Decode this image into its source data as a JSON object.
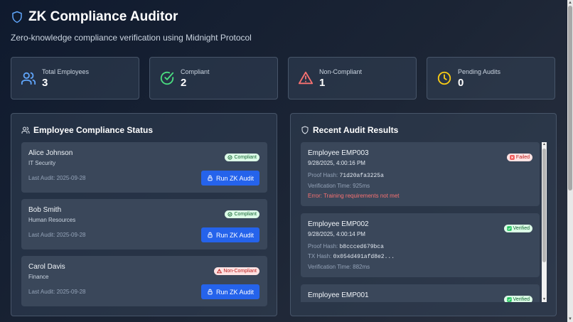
{
  "header": {
    "title": "ZK Compliance Auditor",
    "subtitle": "Zero-knowledge compliance verification using Midnight Protocol"
  },
  "stats": [
    {
      "label": "Total Employees",
      "value": "3",
      "icon": "users-icon",
      "color": "#60a5fa"
    },
    {
      "label": "Compliant",
      "value": "2",
      "icon": "check-circle-icon",
      "color": "#4ade80"
    },
    {
      "label": "Non-Compliant",
      "value": "1",
      "icon": "alert-triangle-icon",
      "color": "#f87171"
    },
    {
      "label": "Pending Audits",
      "value": "0",
      "icon": "clock-icon",
      "color": "#facc15"
    }
  ],
  "employees_panel": {
    "title": "Employee Compliance Status",
    "employees": [
      {
        "name": "Alice Johnson",
        "department": "IT Security",
        "last_audit": "Last Audit: 2025-09-28",
        "status": "Compliant",
        "button": "Run ZK Audit"
      },
      {
        "name": "Bob Smith",
        "department": "Human Resources",
        "last_audit": "Last Audit: 2025-09-28",
        "status": "Compliant",
        "button": "Run ZK Audit"
      },
      {
        "name": "Carol Davis",
        "department": "Finance",
        "last_audit": "Last Audit: 2025-09-28",
        "status": "Non-Compliant",
        "button": "Run ZK Audit"
      }
    ]
  },
  "audit_panel": {
    "title": "Recent Audit Results",
    "results": [
      {
        "title": "Employee EMP003",
        "time": "9/28/2025, 4:00:16 PM",
        "status": "Failed",
        "proof_label": "Proof Hash:",
        "proof_hash": "71d20afa3225a",
        "verification": "Verification Time: 925ms",
        "error": "Error: Training requirements not met"
      },
      {
        "title": "Employee EMP002",
        "time": "9/28/2025, 4:00:14 PM",
        "status": "Verified",
        "proof_label": "Proof Hash:",
        "proof_hash": "b8ccced679bca",
        "tx_label": "TX Hash:",
        "tx_hash": "0x054d491afd8e2...",
        "verification": "Verification Time: 882ms"
      },
      {
        "title": "Employee EMP001",
        "status": "Verified"
      }
    ]
  },
  "colors": {
    "accent": "#2563eb",
    "compliant_bg": "#dcfce7",
    "noncompliant_bg": "#fee2e2",
    "error_text": "#f87171"
  }
}
